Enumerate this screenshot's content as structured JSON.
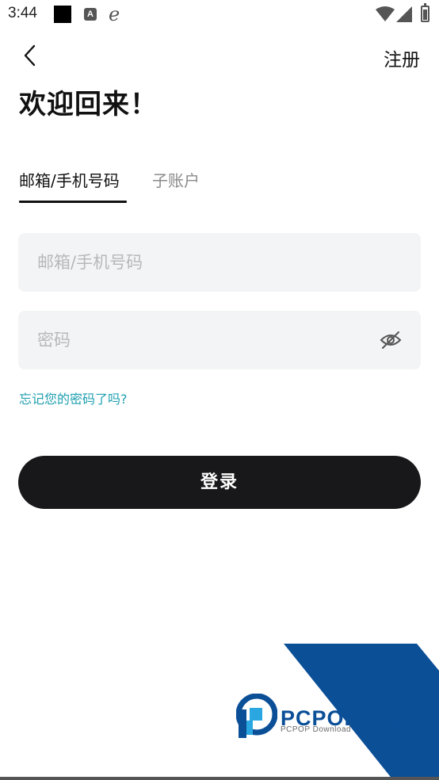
{
  "status_bar": {
    "time": "3:44",
    "icons": [
      "notification-square-icon",
      "a-app-icon",
      "e-app-icon",
      "wifi-icon",
      "signal-icon",
      "battery-icon"
    ]
  },
  "header": {
    "back_icon": "chevron-left-icon",
    "register_label": "注册"
  },
  "page": {
    "title": "欢迎回来！"
  },
  "tabs": [
    {
      "label": "邮箱/手机号码",
      "active": true
    },
    {
      "label": "子账户",
      "active": false
    }
  ],
  "form": {
    "email_placeholder": "邮箱/手机号码",
    "email_value": "",
    "password_placeholder": "密码",
    "password_value": "",
    "password_toggle_icon": "eye-off-icon",
    "forgot_label": "忘记您的密码了吗?",
    "login_label": "登录"
  },
  "watermark": {
    "brand": "PCPOP下载",
    "subtitle": "PCPOP Download"
  },
  "colors": {
    "accent_link": "#1e9fb0",
    "button_bg": "#18181a",
    "input_bg": "#f3f4f6",
    "watermark_blue": "#0b4f97"
  }
}
